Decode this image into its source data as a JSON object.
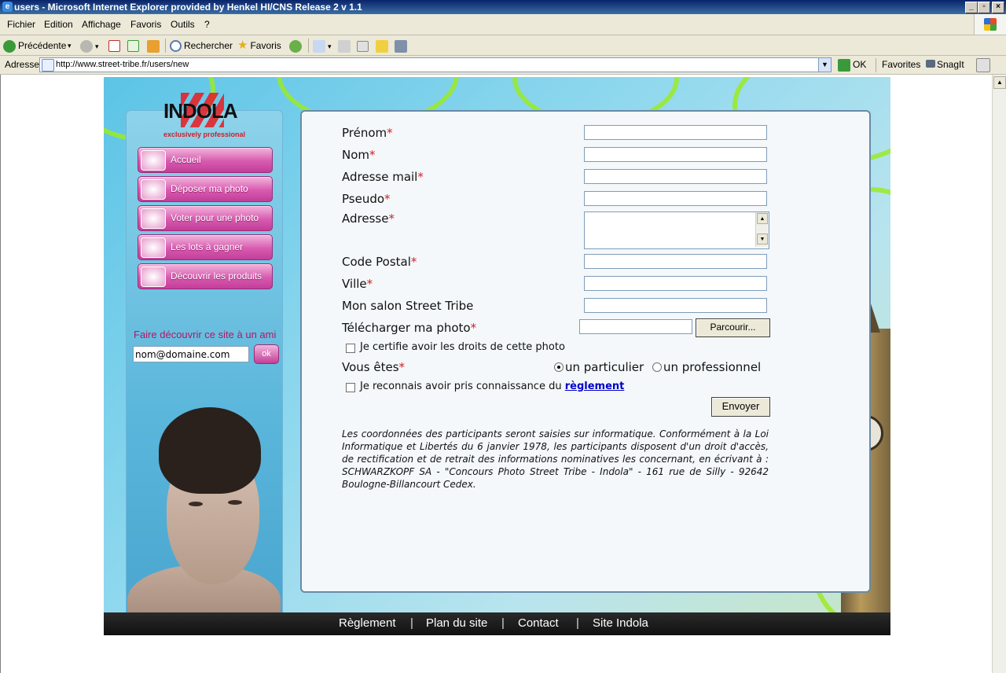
{
  "window": {
    "title": "users - Microsoft Internet Explorer provided by Henkel HI/CNS Release 2 v 1.1"
  },
  "menu": [
    "Fichier",
    "Edition",
    "Affichage",
    "Favoris",
    "Outils",
    "?"
  ],
  "toolbar": {
    "back": "Précédente",
    "search": "Rechercher",
    "favorites": "Favoris"
  },
  "address": {
    "label": "Adresse",
    "url": "http://www.street-tribe.fr/users/new",
    "go": "OK",
    "links": "Favorites",
    "snagit": "SnagIt"
  },
  "site": {
    "logo": {
      "word": "INDOLA",
      "tagline": "exclusively professional"
    },
    "nav": [
      "Accueil",
      "Déposer ma photo",
      "Voter pour une photo",
      "Les lots à gagner",
      "Découvrir les produits"
    ],
    "friend": {
      "label": "Faire découvrir ce site à un ami",
      "value": "nom@domaine.com",
      "button": "ok"
    }
  },
  "form": {
    "fields": [
      "Prénom",
      "Nom",
      "Adresse mail",
      "Pseudo",
      "Adresse",
      "Code Postal",
      "Ville",
      "Mon salon Street Tribe",
      "Télécharger ma photo"
    ],
    "required_mark": "*",
    "browse": "Parcourir...",
    "rights_checkbox": "Je certifie avoir les droits de cette photo",
    "you_are": "Vous êtes",
    "options": [
      "un particulier",
      "un professionnel"
    ],
    "selected_option": "un particulier",
    "rules_prefix": "Je reconnais avoir pris connaissance du",
    "rules_link": "règlement",
    "submit": "Envoyer",
    "legal": "Les coordonnées des participants seront saisies sur informatique. Conformément à la Loi Informatique et Libertés du 6 janvier 1978, les participants disposent d'un droit d'accès, de rectification et de retrait des informations nominatives les concernant, en écrivant à : SCHWARZKOPF SA - \"Concours Photo Street Tribe - Indola\" - 161 rue de Silly - 92642 Boulogne-Billancourt Cedex."
  },
  "footer": [
    "Règlement",
    "Plan du site",
    "Contact",
    "Site Indola"
  ],
  "footer_sep": "|",
  "colors": {
    "accent_pink": "#c23e98",
    "required_red": "#d0202a",
    "link_blue": "#0000cc",
    "vine_green": "#9bea26"
  }
}
